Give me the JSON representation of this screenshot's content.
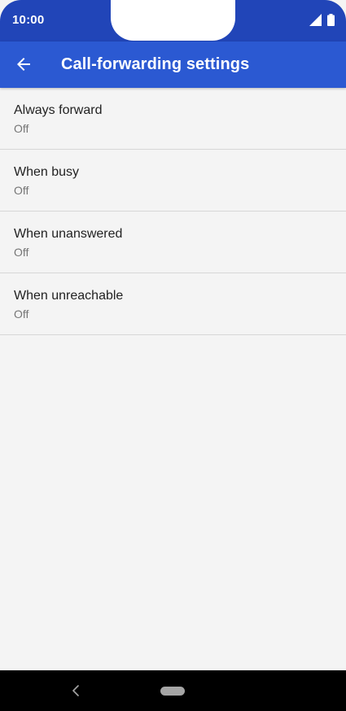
{
  "status_bar": {
    "time": "10:00",
    "icons": [
      "cell-signal-icon",
      "battery-icon"
    ]
  },
  "app_bar": {
    "title": "Call-forwarding settings",
    "back_icon": "arrow-left-icon"
  },
  "settings": {
    "items": [
      {
        "title": "Always forward",
        "summary": "Off"
      },
      {
        "title": "When busy",
        "summary": "Off"
      },
      {
        "title": "When unanswered",
        "summary": "Off"
      },
      {
        "title": "When unreachable",
        "summary": "Off"
      }
    ]
  },
  "nav_bar": {
    "back_icon": "chevron-left-icon",
    "home_icon": "home-pill-icon"
  },
  "colors": {
    "status_bar": "#2145b8",
    "app_bar": "#2b59d2",
    "background": "#f4f4f4",
    "nav_bar": "#000000"
  }
}
